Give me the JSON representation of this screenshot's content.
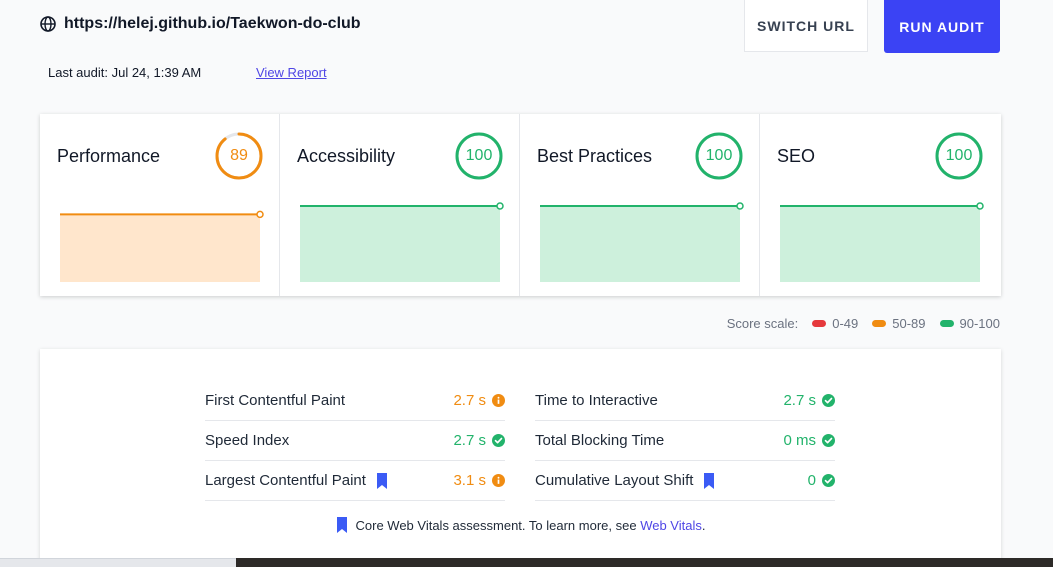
{
  "header": {
    "url": "https://helej.github.io/Taekwon-do-club",
    "switch_label": "SWITCH URL",
    "run_label": "RUN AUDIT",
    "last_audit": "Last audit: Jul 24, 1:39 AM",
    "view_report": "View Report"
  },
  "colors": {
    "orange": "#f08c12",
    "green": "#22b36b",
    "red": "#e5393c",
    "accent": "#3b43f4",
    "orange_fill": "#ffe6cc",
    "green_fill": "#cdf0dc"
  },
  "cards": [
    {
      "title": "Performance",
      "score": "89",
      "value": 89,
      "status": "orange"
    },
    {
      "title": "Accessibility",
      "score": "100",
      "value": 100,
      "status": "green"
    },
    {
      "title": "Best Practices",
      "score": "100",
      "value": 100,
      "status": "green"
    },
    {
      "title": "SEO",
      "score": "100",
      "value": 100,
      "status": "green"
    }
  ],
  "scale": {
    "label": "Score scale:",
    "ranges": [
      {
        "label": "0-49",
        "status": "red"
      },
      {
        "label": "50-89",
        "status": "orange"
      },
      {
        "label": "90-100",
        "status": "green"
      }
    ]
  },
  "metrics": {
    "left": [
      {
        "label": "First Contentful Paint",
        "value": "2.7 s",
        "status": "orange",
        "core": false
      },
      {
        "label": "Speed Index",
        "value": "2.7 s",
        "status": "green",
        "core": false
      },
      {
        "label": "Largest Contentful Paint",
        "value": "3.1 s",
        "status": "orange",
        "core": true
      }
    ],
    "right": [
      {
        "label": "Time to Interactive",
        "value": "2.7 s",
        "status": "green",
        "core": false
      },
      {
        "label": "Total Blocking Time",
        "value": "0 ms",
        "status": "green",
        "core": false
      },
      {
        "label": "Cumulative Layout Shift",
        "value": "0",
        "status": "green",
        "core": true
      }
    ]
  },
  "footnote": {
    "text": "Core Web Vitals assessment. To learn more, see",
    "link": "Web Vitals",
    "suffix": "."
  }
}
